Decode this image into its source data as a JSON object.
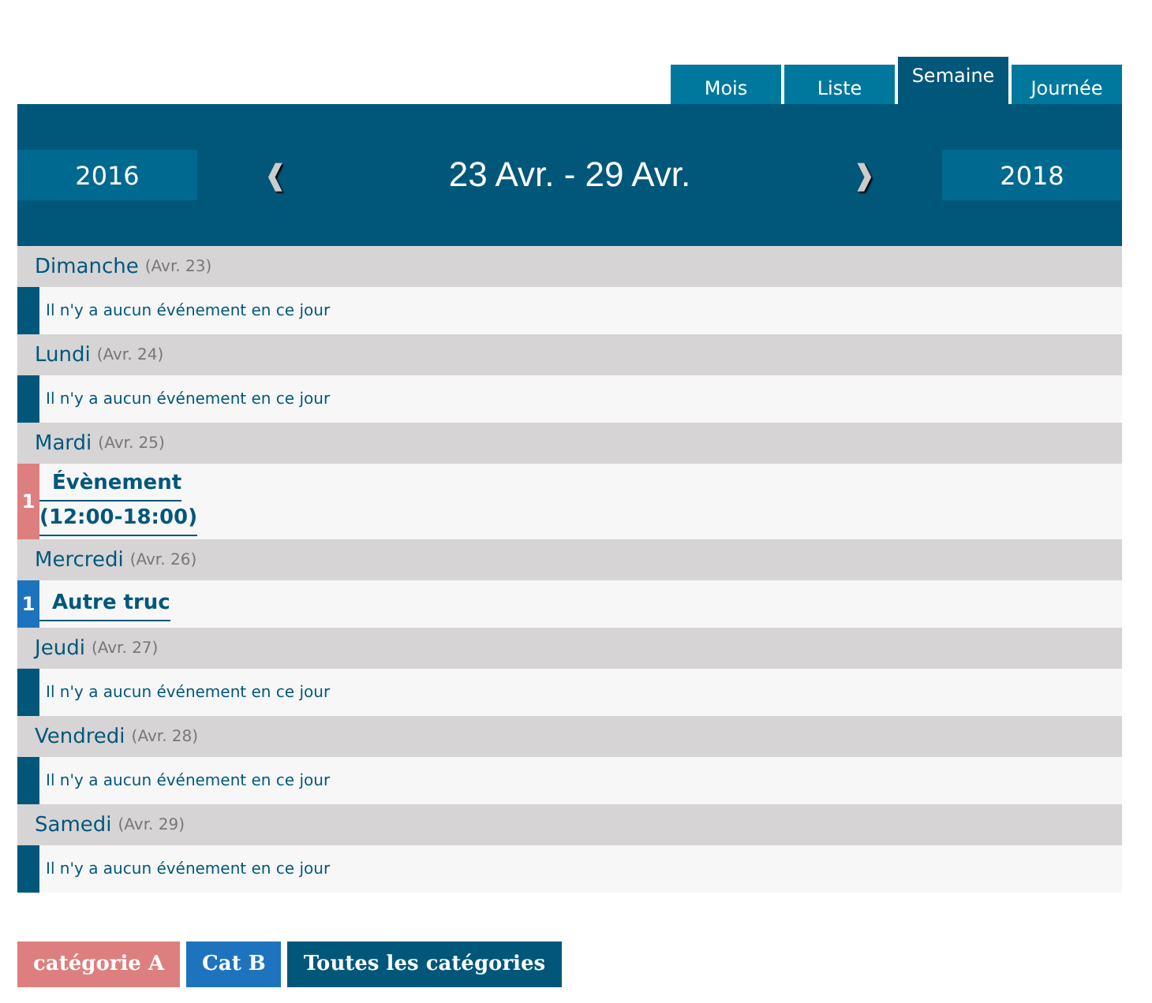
{
  "tabs": [
    {
      "label": "Mois",
      "selected": false
    },
    {
      "label": "Liste",
      "selected": false
    },
    {
      "label": "Semaine",
      "selected": true
    },
    {
      "label": "Journée",
      "selected": false
    }
  ],
  "header": {
    "prev_year": "2016",
    "prev_arrow": "❰",
    "range": "23 Avr. - 29 Avr.",
    "next_arrow": "❱",
    "next_year": "2018"
  },
  "days": [
    {
      "name": "Dimanche",
      "date": "(Avr. 23)",
      "empty_text": "Il n'y a aucun événement en ce jour"
    },
    {
      "name": "Lundi",
      "date": "(Avr. 24)",
      "empty_text": "Il n'y a aucun événement en ce jour"
    },
    {
      "name": "Mardi",
      "date": "(Avr. 25)",
      "count": "1",
      "color": "#de7f7f",
      "events": [
        {
          "title": "Évènement",
          "time": "(12:00-18:00)"
        }
      ]
    },
    {
      "name": "Mercredi",
      "date": "(Avr. 26)",
      "count": "1",
      "color": "#1e73be",
      "events": [
        {
          "title": "Autre truc"
        }
      ]
    },
    {
      "name": "Jeudi",
      "date": "(Avr. 27)",
      "empty_text": "Il n'y a aucun événement en ce jour"
    },
    {
      "name": "Vendredi",
      "date": "(Avr. 28)",
      "empty_text": "Il n'y a aucun événement en ce jour"
    },
    {
      "name": "Samedi",
      "date": "(Avr. 29)",
      "empty_text": "Il n'y a aucun événement en ce jour"
    }
  ],
  "categories": [
    {
      "label": "catégorie A",
      "color": "#de7f7f"
    },
    {
      "label": "Cat B",
      "color": "#1e73be"
    },
    {
      "label": "Toutes les catégories",
      "color": "#00577a"
    }
  ]
}
